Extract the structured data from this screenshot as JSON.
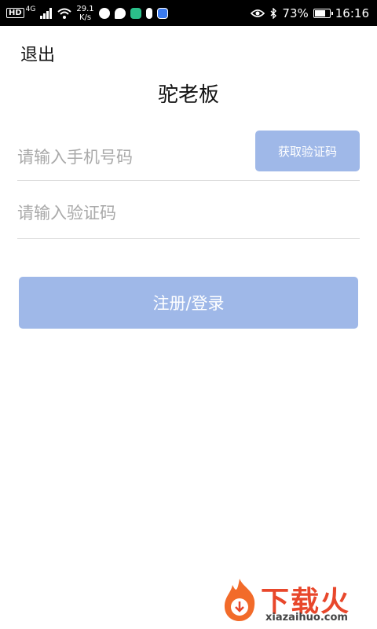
{
  "status_bar": {
    "network": "4G",
    "hd": "HD",
    "speed_value": "29.1",
    "speed_unit": "K/s",
    "battery_percent": "73%",
    "battery_level": 0.73,
    "time": "16:16"
  },
  "header": {
    "exit_label": "退出",
    "title": "驼老板"
  },
  "form": {
    "phone_placeholder": "请输入手机号码",
    "phone_value": "",
    "code_placeholder": "请输入验证码",
    "code_value": "",
    "get_code_label": "获取验证码",
    "submit_label": "注册/登录"
  },
  "colors": {
    "button_bg": "#9fb8e8",
    "watermark": "#e8472b"
  },
  "watermark": {
    "brand": "下载火",
    "url": "xiazaihuo.com"
  }
}
